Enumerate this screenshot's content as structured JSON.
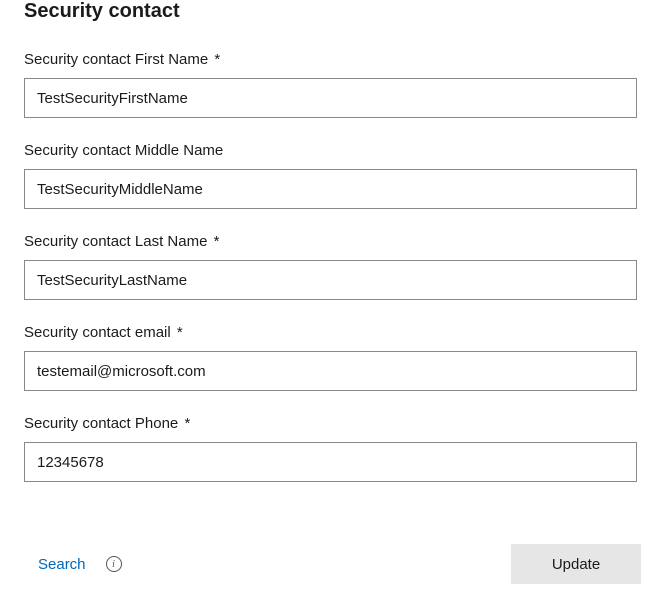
{
  "section": {
    "title": "Security contact"
  },
  "fields": {
    "firstName": {
      "label": "Security contact First Name",
      "required": "*",
      "value": "TestSecurityFirstName"
    },
    "middleName": {
      "label": "Security contact Middle Name",
      "required": "",
      "value": "TestSecurityMiddleName"
    },
    "lastName": {
      "label": "Security contact Last Name",
      "required": "*",
      "value": "TestSecurityLastName"
    },
    "email": {
      "label": "Security contact email",
      "required": "*",
      "value": "testemail@microsoft.com"
    },
    "phone": {
      "label": "Security contact Phone",
      "required": "*",
      "value": "12345678"
    }
  },
  "footer": {
    "search_label": "Search",
    "info_glyph": "i",
    "update_label": "Update"
  }
}
